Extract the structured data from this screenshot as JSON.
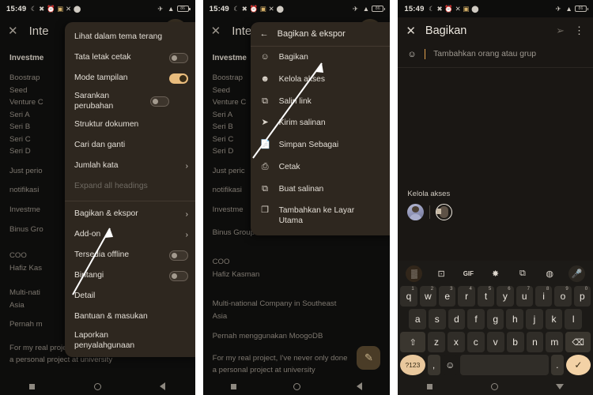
{
  "statusbar": {
    "time": "15:49",
    "left_icons": [
      "moon-icon",
      "mute-icon",
      "alarm-icon",
      "photos-icon",
      "x-app-icon",
      "circle-icon"
    ],
    "right_icons": [
      "airplane-icon",
      "wifi-icon",
      "battery-icon"
    ],
    "battery_level": "86"
  },
  "panel1": {
    "name": "docs-overflow-menu-panel",
    "appbar": {
      "close_icon": "close-icon",
      "title": "Inte"
    },
    "document": {
      "heading": "Investme",
      "lines": [
        "Boostrap",
        "Seed",
        "Venture C",
        "Seri A",
        "Seri B",
        "Seri C",
        "Seri D",
        "Just perio",
        "notifikasi",
        "Investme",
        "Binus Gro",
        "COO",
        "Hafiz Kas",
        "Multi-nati",
        "Asia",
        "Pernah m"
      ],
      "footer_line1": "For my real project, I've never only done",
      "footer_line2": "a personal project at university"
    },
    "menu": {
      "items": [
        {
          "label": "Lihat dalam tema terang",
          "type": "plain"
        },
        {
          "label": "Tata letak cetak",
          "type": "toggle",
          "toggle": "off"
        },
        {
          "label": "Mode tampilan",
          "type": "toggle",
          "toggle": "on"
        },
        {
          "label": "Sarankan perubahan",
          "type": "toggle",
          "toggle": "off"
        },
        {
          "label": "Struktur dokumen",
          "type": "plain"
        },
        {
          "label": "Cari dan ganti",
          "type": "plain"
        },
        {
          "label": "Jumlah kata",
          "type": "submenu"
        },
        {
          "label": "Expand all headings",
          "type": "disabled"
        },
        {
          "label": "Bagikan & ekspor",
          "type": "submenu"
        },
        {
          "label": "Add-on",
          "type": "submenu"
        },
        {
          "label": "Tersedia offline",
          "type": "toggle",
          "toggle": "off"
        },
        {
          "label": "Bintangi",
          "type": "toggle",
          "toggle": "off"
        },
        {
          "label": "Detail",
          "type": "plain"
        },
        {
          "label": "Bantuan & masukan",
          "type": "plain"
        },
        {
          "label": "Laporkan penyalahgunaan",
          "type": "plain"
        }
      ]
    }
  },
  "panel2": {
    "name": "share-export-submenu-panel",
    "appbar": {
      "close_icon": "close-icon",
      "title": "Inte"
    },
    "document": {
      "heading": "Investme",
      "lines": [
        "Boostrap",
        "Seed",
        "Venture C",
        "Seri A",
        "Seri B",
        "Seri C",
        "Seri D",
        "Just peric",
        "notifikasi",
        "Investme"
      ],
      "body": [
        "Binus Group",
        "COO",
        "Hafiz Kasman",
        "Multi-national Company in Southeast",
        "Asia",
        "Pernah menggunakan MoogoDB"
      ],
      "footer_line1": "For my real project, I've never only done",
      "footer_line2": "a personal project at university"
    },
    "submenu": {
      "back_icon": "arrow-left-icon",
      "title": "Bagikan & ekspor",
      "items": [
        {
          "label": "Bagikan",
          "icon": "person-add-icon",
          "glyph": "☺"
        },
        {
          "label": "Kelola akses",
          "icon": "people-icon",
          "glyph": "☻"
        },
        {
          "label": "Salin link",
          "icon": "copy-link-icon",
          "glyph": "⧉"
        },
        {
          "label": "Kirim salinan",
          "icon": "send-icon",
          "glyph": "➤"
        },
        {
          "label": "Simpan Sebagai",
          "icon": "file-icon",
          "glyph": "✐"
        },
        {
          "label": "Cetak",
          "icon": "printer-icon",
          "glyph": "⎙"
        },
        {
          "label": "Buat salinan",
          "icon": "duplicate-icon",
          "glyph": "⧉"
        },
        {
          "label": "Tambahkan ke Layar Utama",
          "icon": "add-to-homescreen-icon",
          "glyph": "❐"
        }
      ]
    }
  },
  "panel3": {
    "name": "share-dialog-panel",
    "header": {
      "close_icon": "close-icon",
      "title": "Bagikan",
      "send_icon": "send-icon",
      "kebab_icon": "more-vert-icon"
    },
    "input": {
      "icon": "person-add-icon",
      "value": "",
      "placeholder": "Tambahkan orang atau grup"
    },
    "access": {
      "title": "Kelola akses",
      "avatars": [
        "avatar-person-1",
        "avatar-person-2"
      ]
    },
    "keyboard": {
      "toolbar": [
        "apps-icon",
        "sticker-icon",
        "GIF",
        "gear-icon",
        "translate-icon",
        "palette-icon",
        "mic-icon"
      ],
      "row1": [
        {
          "k": "q",
          "n": "1"
        },
        {
          "k": "w",
          "n": "2"
        },
        {
          "k": "e",
          "n": "3"
        },
        {
          "k": "r",
          "n": "4"
        },
        {
          "k": "t",
          "n": "5"
        },
        {
          "k": "y",
          "n": "6"
        },
        {
          "k": "u",
          "n": "7"
        },
        {
          "k": "i",
          "n": "8"
        },
        {
          "k": "o",
          "n": "9"
        },
        {
          "k": "p",
          "n": "0"
        }
      ],
      "row2": [
        "a",
        "s",
        "d",
        "f",
        "g",
        "h",
        "j",
        "k",
        "l"
      ],
      "row3": {
        "shift": "⇧",
        "keys": [
          "z",
          "x",
          "c",
          "v",
          "b",
          "n",
          "m"
        ],
        "backspace": "⌫"
      },
      "row4": {
        "sym": "?123",
        "comma": ",",
        "emoji": "☺",
        "space": "",
        "period": ".",
        "enter": "✓"
      }
    },
    "navbar": [
      "square-icon",
      "circle-icon",
      "triangle-icon"
    ]
  },
  "colors": {
    "menu_bg": "#2e271f",
    "accent_on": "#e9bc7d",
    "key_accent": "#e9c89d",
    "page_bg": "#0d0d0c"
  }
}
